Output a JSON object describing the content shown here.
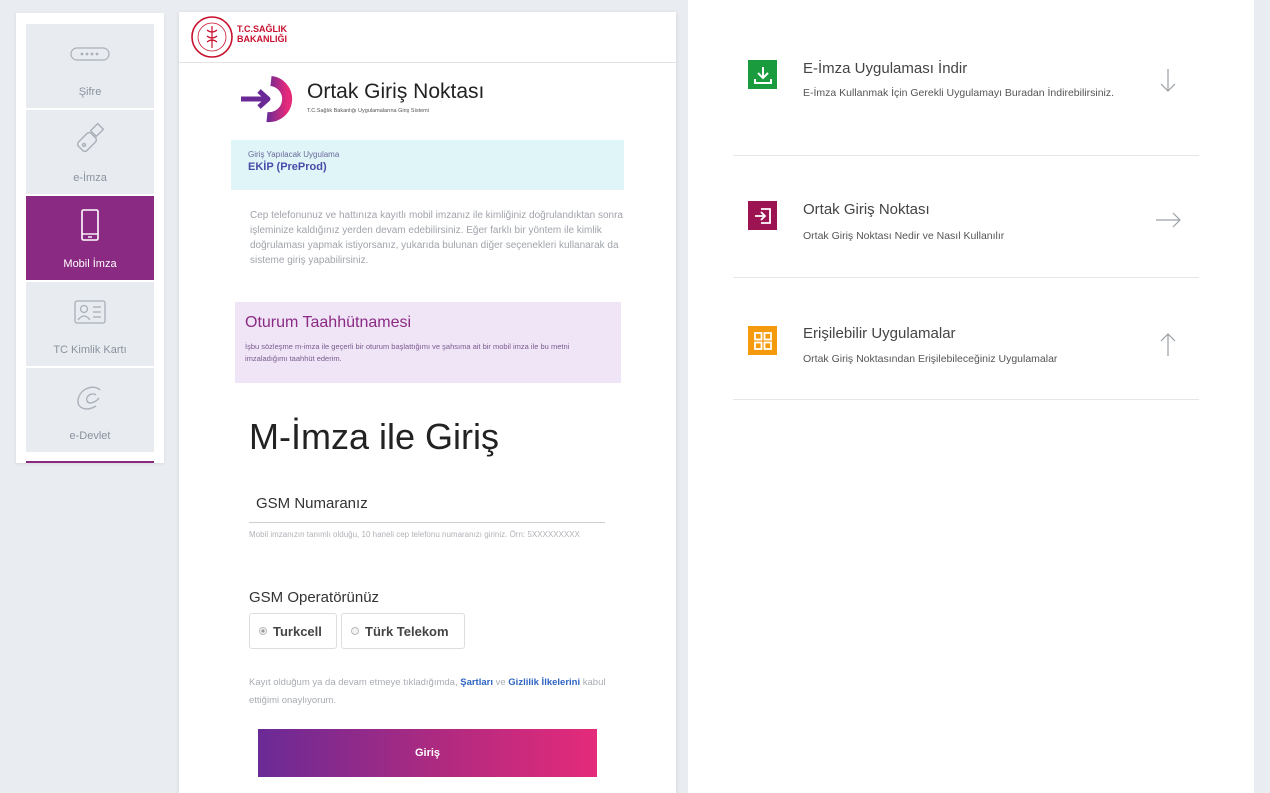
{
  "sidebar": {
    "items": [
      {
        "label": "Şifre"
      },
      {
        "label": "e-İmza"
      },
      {
        "label": "Mobil İmza"
      },
      {
        "label": "TC Kimlik Kartı"
      },
      {
        "label": "e-Devlet"
      }
    ]
  },
  "header": {
    "ministry_line1": "T.C.SAĞLIK",
    "ministry_line2": "BAKANLIĞI"
  },
  "brand": {
    "title": "Ortak Giriş Noktası",
    "subtitle": "T.C.Sağlık Bakanlığı Uygulamalarına Giriş Sistemi"
  },
  "app": {
    "caption": "Giriş Yapılacak Uygulama",
    "name": "EKİP (PreProd)"
  },
  "info_text": "Cep telefonunuz ve hattınıza kayıtlı mobil imzanız ile kimliğiniz doğrulandıktan sonra işleminize kaldığınız yerden devam edebilirsiniz. Eğer farklı bir yöntem ile kimlik doğrulaması yapmak istiyorsanız, yukarıda bulunan diğer seçenekleri kullanarak da sisteme giriş yapabilirsiniz.",
  "taahhut": {
    "title": "Oturum Taahhütnamesi",
    "text": "İşbu sözleşme m-imza ile geçerli bir oturum başlattığımı ve şahsıma ait bir mobil imza ile bu metni imzaladığımı taahhüt ederim."
  },
  "form": {
    "title": "M-İmza ile Giriş",
    "gsm_label": "GSM Numaranız",
    "gsm_value": "",
    "gsm_hint": "Mobil imzanızın tanımlı olduğu, 10 haneli cep telefonu numaranızı giriniz. Örn: 5XXXXXXXXX",
    "operator_label": "GSM Operatörünüz",
    "operators": [
      {
        "label": "Turkcell",
        "selected": true
      },
      {
        "label": "Türk Telekom",
        "selected": false
      }
    ],
    "consent_1": "Kayıt olduğum ya da devam etmeye tıkladığımda, ",
    "consent_link1": "Şartları",
    "consent_2": " ve ",
    "consent_link2": "Gizlilik İlkelerini",
    "consent_3": " kabul ettiğimi onaylıyorum.",
    "submit_label": "Giriş"
  },
  "right_panel": [
    {
      "title": "E-İmza Uygulaması İndir",
      "desc": "E-İmza Kullanmak İçin Gerekli Uygulamayı Buradan İndirebilirsiniz.",
      "icon": "download-icon",
      "arrow": "arrow-down-icon",
      "color": "#1a9c3e"
    },
    {
      "title": "Ortak Giriş Noktası",
      "desc": "Ortak Giriş Noktası Nedir ve Nasıl Kullanılır",
      "icon": "login-icon",
      "arrow": "arrow-right-icon",
      "color": "#9c1552"
    },
    {
      "title": "Erişilebilir Uygulamalar",
      "desc": "Ortak Giriş Noktasından Erişilebileceğiniz Uygulamalar",
      "icon": "apps-grid-icon",
      "arrow": "arrow-up-icon",
      "color": "#f59a0c"
    }
  ],
  "colors": {
    "brand_purple": "#8b2a83",
    "page_bg": "#e9ecf1",
    "link": "#2e64c2"
  }
}
